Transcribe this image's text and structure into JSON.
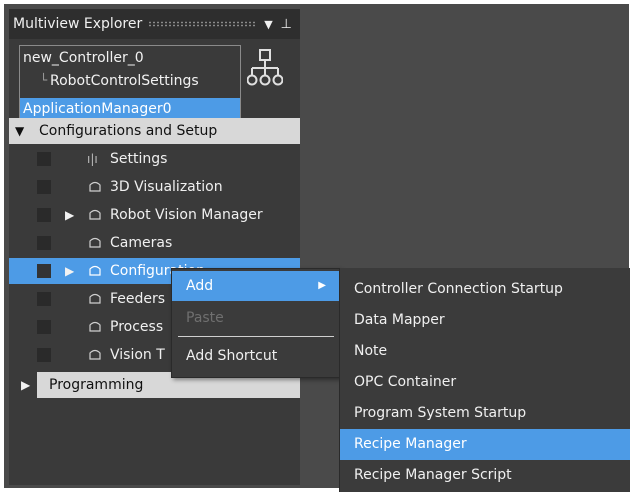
{
  "explorer": {
    "title": "Multiview Explorer",
    "dropdown_glyph": "▼",
    "pin_glyph": "⊥"
  },
  "controllers": {
    "controller": "new_Controller_0",
    "robot_settings": "RobotControlSettings",
    "app_manager": "ApplicationManager0",
    "tree_icon": "hierarchy-icon"
  },
  "tree": {
    "section_config": "Configurations and Setup",
    "items": [
      {
        "label": "Settings",
        "icon": "sliders-icon"
      },
      {
        "label": "3D Visualization",
        "icon": "folder-icon"
      },
      {
        "label": "Robot Vision Manager",
        "icon": "folder-icon"
      },
      {
        "label": "Cameras",
        "icon": "folder-icon"
      },
      {
        "label": "Configuration",
        "icon": "folder-icon"
      },
      {
        "label": "Feeders",
        "icon": "folder-icon"
      },
      {
        "label": "Process",
        "icon": "folder-icon"
      },
      {
        "label": "Vision T",
        "icon": "folder-icon"
      }
    ],
    "section_programming": "Programming"
  },
  "context_menu": {
    "add": "Add",
    "paste": "Paste",
    "add_shortcut": "Add Shortcut"
  },
  "submenu": {
    "items": [
      "Controller Connection Startup",
      "Data Mapper",
      "Note",
      "OPC Container",
      "Program System Startup",
      "Recipe Manager",
      "Recipe Manager Script"
    ],
    "highlighted": "Recipe Manager"
  },
  "colors": {
    "selection": "#4d9be6",
    "panel": "#3a3a3a",
    "section_header": "#d8d8d8"
  }
}
